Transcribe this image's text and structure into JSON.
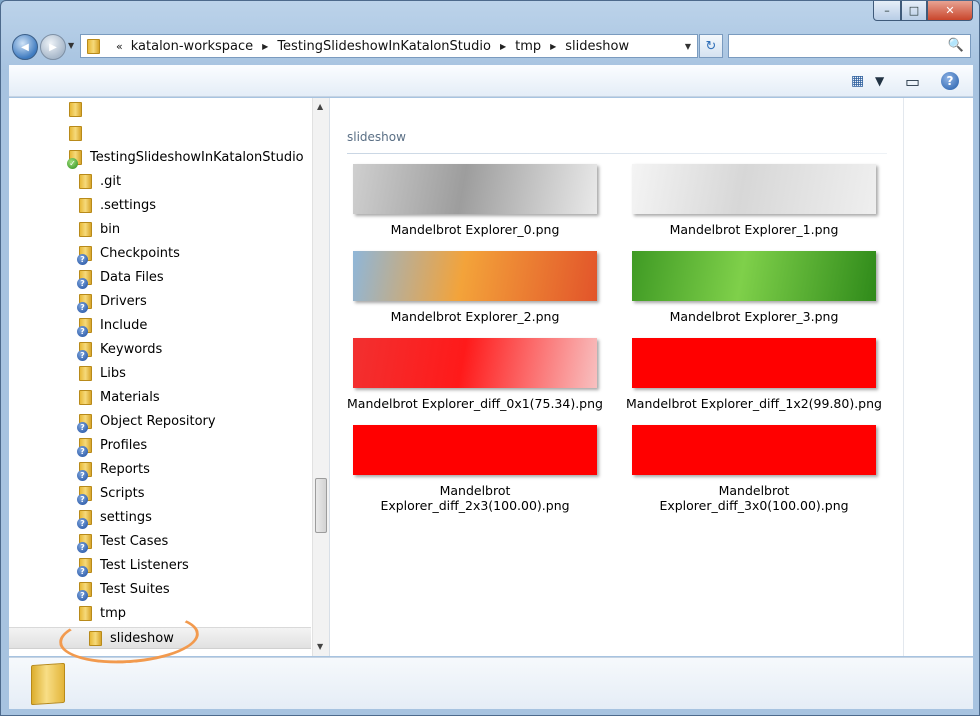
{
  "window": {
    "caption_buttons": {
      "minimize": "–",
      "maximize": "□",
      "close": "✕"
    }
  },
  "navigation": {
    "back_glyph": "◀",
    "forward_glyph": "▶",
    "recent_glyph": "▼"
  },
  "address_bar": {
    "lead": "«",
    "crumbs": [
      "katalon-workspace",
      "TestingSlideshowInKatalonStudio",
      "tmp",
      "slideshow"
    ],
    "separator": "▶",
    "dropdown_glyph": "▼",
    "refresh_glyph": "↻"
  },
  "search": {
    "icon": "search-icon",
    "glyph": "🔍"
  },
  "toolbar": {
    "change_view_glyph": "▦",
    "change_view_dropdown": "▼",
    "preview_pane_glyph": "▭",
    "help_glyph": "?"
  },
  "tree": {
    "items": [
      {
        "label": "",
        "icon": "folder-icon"
      },
      {
        "label": "",
        "icon": "folder-icon"
      },
      {
        "label": "TestingSlideshowInKatalonStudio",
        "icon": "folder-check-icon"
      },
      {
        "label": ".git",
        "icon": "folder-icon"
      },
      {
        "label": ".settings",
        "icon": "folder-icon"
      },
      {
        "label": "bin",
        "icon": "folder-icon"
      },
      {
        "label": "Checkpoints",
        "icon": "folder-badge-icon"
      },
      {
        "label": "Data Files",
        "icon": "folder-badge-icon"
      },
      {
        "label": "Drivers",
        "icon": "folder-badge-icon"
      },
      {
        "label": "Include",
        "icon": "folder-badge-icon"
      },
      {
        "label": "Keywords",
        "icon": "folder-badge-icon"
      },
      {
        "label": "Libs",
        "icon": "folder-icon"
      },
      {
        "label": "Materials",
        "icon": "folder-icon"
      },
      {
        "label": "Object Repository",
        "icon": "folder-badge-icon"
      },
      {
        "label": "Profiles",
        "icon": "folder-badge-icon"
      },
      {
        "label": "Reports",
        "icon": "folder-badge-icon"
      },
      {
        "label": "Scripts",
        "icon": "folder-badge-icon"
      },
      {
        "label": "settings",
        "icon": "folder-badge-icon"
      },
      {
        "label": "Test Cases",
        "icon": "folder-badge-icon"
      },
      {
        "label": "Test Listeners",
        "icon": "folder-badge-icon"
      },
      {
        "label": "Test Suites",
        "icon": "folder-badge-icon"
      },
      {
        "label": "tmp",
        "icon": "folder-icon"
      },
      {
        "label": "slideshow",
        "icon": "folder-icon",
        "selected": true
      }
    ],
    "scroll_up": "▲",
    "scroll_down": "▼"
  },
  "files": {
    "header": "slideshow",
    "items": [
      {
        "name": "Mandelbrot Explorer_0.png",
        "colors": [
          "#cfcfcf",
          "#9d9d9d",
          "#e9e9e9"
        ]
      },
      {
        "name": "Mandelbrot Explorer_1.png",
        "colors": [
          "#f4f4f4",
          "#d7d7d7",
          "#efefef"
        ]
      },
      {
        "name": "Mandelbrot Explorer_2.png",
        "colors": [
          "#8fb6d8",
          "#f3a33a",
          "#e2542a"
        ]
      },
      {
        "name": "Mandelbrot Explorer_3.png",
        "colors": [
          "#3f9a24",
          "#7fd04a",
          "#2f8a1a"
        ]
      },
      {
        "name": "Mandelbrot Explorer_diff_0x1(75.34).png",
        "colors": [
          "#f23030",
          "#ff1a1a",
          "#f8c0c0"
        ]
      },
      {
        "name": "Mandelbrot Explorer_diff_1x2(99.80).png",
        "colors": [
          "#ff0000",
          "#ff0000",
          "#ff0000"
        ]
      },
      {
        "name": "Mandelbrot Explorer_diff_2x3(100.00).png",
        "colors": [
          "#ff0000",
          "#ff0000",
          "#ff0000"
        ]
      },
      {
        "name": "Mandelbrot Explorer_diff_3x0(100.00).png",
        "colors": [
          "#ff0000",
          "#ff0000",
          "#ff0000"
        ]
      }
    ]
  },
  "colors": {
    "annotation": "#f29a4e",
    "selection": "#e3e3e3"
  }
}
